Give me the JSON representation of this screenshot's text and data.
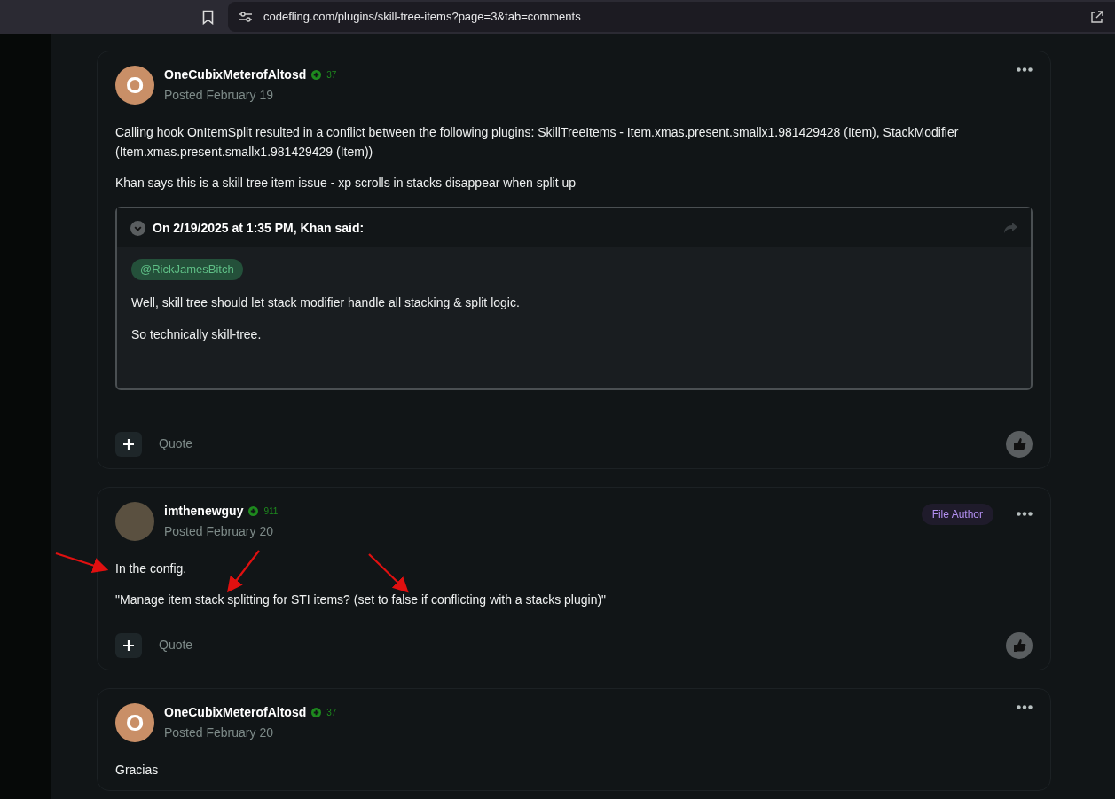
{
  "browser": {
    "url": "codefling.com/plugins/skill-tree-items?page=3&tab=comments"
  },
  "posts": [
    {
      "author": "OneCubixMeterofAltosd",
      "avatar": {
        "kind": "letter",
        "letter": "O"
      },
      "reputation": "37",
      "posted": "Posted February 19",
      "paragraphs": [
        "Calling hook OnItemSplit resulted in a conflict between the following plugins: SkillTreeItems - Item.xmas.present.smallx1.981429428 (Item), StackModifier (Item.xmas.present.smallx1.981429429 (Item))",
        "Khan says this is a skill tree item issue - xp scrolls in stacks disappear when split up"
      ],
      "quote": {
        "header": "On 2/19/2025 at 1:35 PM, Khan said:",
        "mention": "@RickJamesBitch",
        "paragraphs": [
          "Well, skill tree should let stack modifier handle all stacking & split logic.",
          "So technically skill-tree."
        ]
      },
      "footer": {
        "quote_label": "Quote"
      }
    },
    {
      "author": "imthenewguy",
      "avatar": {
        "kind": "photo"
      },
      "reputation": "911",
      "posted": "Posted February 20",
      "badge": "File Author",
      "paragraphs": [
        "In the config.",
        "\"Manage item stack splitting for STI items? (set to false if conflicting with a stacks plugin)\""
      ],
      "footer": {
        "quote_label": "Quote"
      }
    },
    {
      "author": "OneCubixMeterofAltosd",
      "avatar": {
        "kind": "letter",
        "letter": "O"
      },
      "reputation": "37",
      "posted": "Posted February 20",
      "paragraphs": [
        "Gracias"
      ]
    }
  ]
}
